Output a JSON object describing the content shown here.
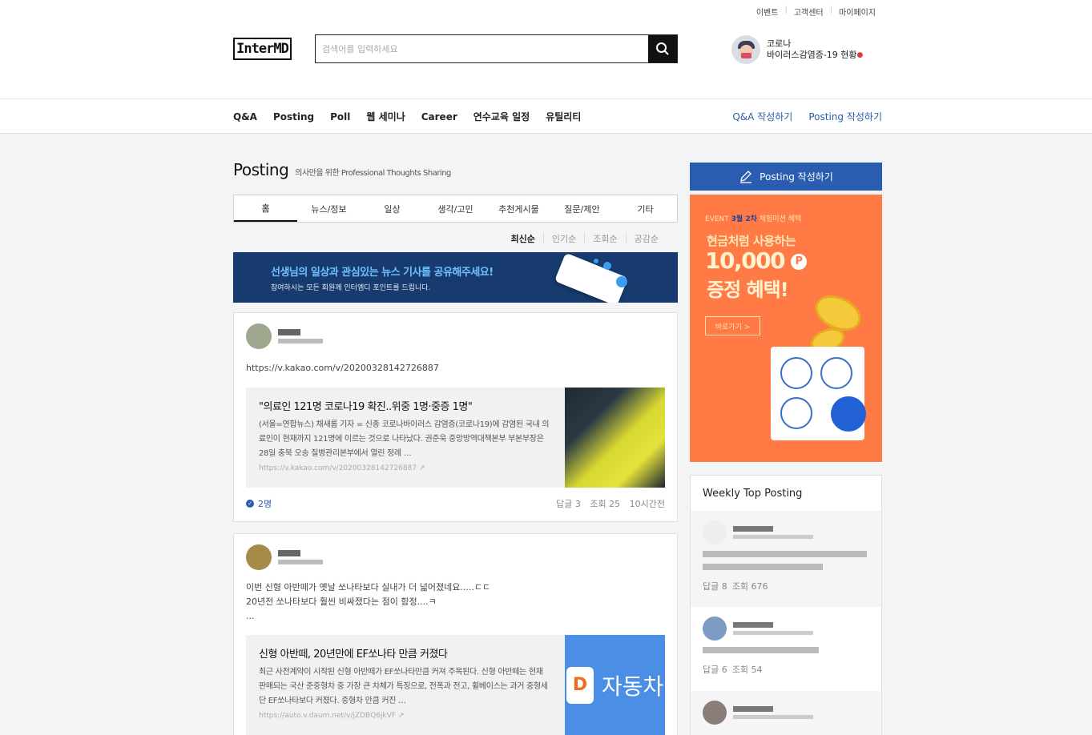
{
  "header": {
    "util_links": [
      "이벤트",
      "고객센터",
      "마이페이지"
    ],
    "logo": "InterMD",
    "search_placeholder": "검색어를 입력하세요",
    "covid_line1": "코로나",
    "covid_line2": "바이러스감염증-19 현황"
  },
  "nav": {
    "items": [
      "Q&A",
      "Posting",
      "Poll",
      "웹 세미나",
      "Career",
      "연수교육 일정",
      "유틸리티"
    ],
    "write_qa": "Q&A 작성하기",
    "write_posting": "Posting 작성하기"
  },
  "page": {
    "title": "Posting",
    "subtitle": "의사만을 위한 Professional Thoughts Sharing"
  },
  "tabs": [
    "홈",
    "뉴스/정보",
    "일상",
    "생각/고민",
    "추천게시물",
    "질문/제안",
    "기타"
  ],
  "sort": [
    "최신순",
    "인기순",
    "조회순",
    "공감순"
  ],
  "banner": {
    "headline": "선생님의 일상과 관심있는 뉴스 기사를 공유해주세요!",
    "sub": "참여하시는 모든 회원께 인터엠디 포인트를 드립니다."
  },
  "posts": [
    {
      "body": "https://v.kakao.com/v/20200328142726887",
      "link_title": "\"의료인 121명 코로나19 확진..위중 1명·중증 1명\"",
      "link_desc": "(서울=연합뉴스) 채새롬 기자 = 신종 코로나바이러스 감염증(코로나19)에 감염된 국내 의료인이 현재까지 121명에 이르는 것으로 나타났다. 권준욱 중앙방역대책본부 부본부장은 28일 충북 오송 질병관리본부에서 열린 정례 …",
      "link_url": "https://v.kakao.com/v/20200328142726887",
      "likes": "2명",
      "replies": "답글 3",
      "views": "조회 25",
      "time": "10시간전"
    },
    {
      "body_line1": "이번 신형 아반떼가 옛날 쏘나타보다 실내가 더 넓어졌네요.....ㄷㄷ",
      "body_line2": "20년전 쏘나타보다 훨씬 비싸졌다는 점이 함정....ㅋ",
      "body_line3": "...",
      "link_title": "신형 아반떼, 20년만에 EF쏘나타 만큼 커졌다",
      "link_desc": "최근 사전계약이 시작된 신형 아반떼가 EF쏘나타만큼 커져 주목된다. 신형 아반떼는 현재 판매되는 국산 준중형차 중 가장 큰 차체가 특징으로, 전폭과 전고, 휠베이스는 과거 중형세단 EF쏘나타보다 커졌다. 중형차 만큼 커진 …",
      "link_url": "https://auto.v.daum.net/v/jZDBQ6jkVF",
      "thumb_text": "자동차"
    }
  ],
  "sidebar": {
    "write_button": "Posting 작성하기",
    "event": {
      "tag_prefix": "EVENT",
      "tag_highlight": "3월 2차",
      "tag_suffix": "체험미션 혜택",
      "line1": "현금처럼 사용하는",
      "amount": "10,000",
      "point_mark": "P",
      "line3": "증정 혜택!",
      "cta": "바로가기 >"
    },
    "weekly_title": "Weekly Top Posting",
    "weekly": [
      {
        "replies": "답글 8",
        "views": "조회 676"
      },
      {
        "replies": "답글 6",
        "views": "조회 54"
      }
    ]
  },
  "colors": {
    "primary": "#2a5db0",
    "banner_bg": "#173b6f",
    "event_bg": "#ff7a45"
  }
}
